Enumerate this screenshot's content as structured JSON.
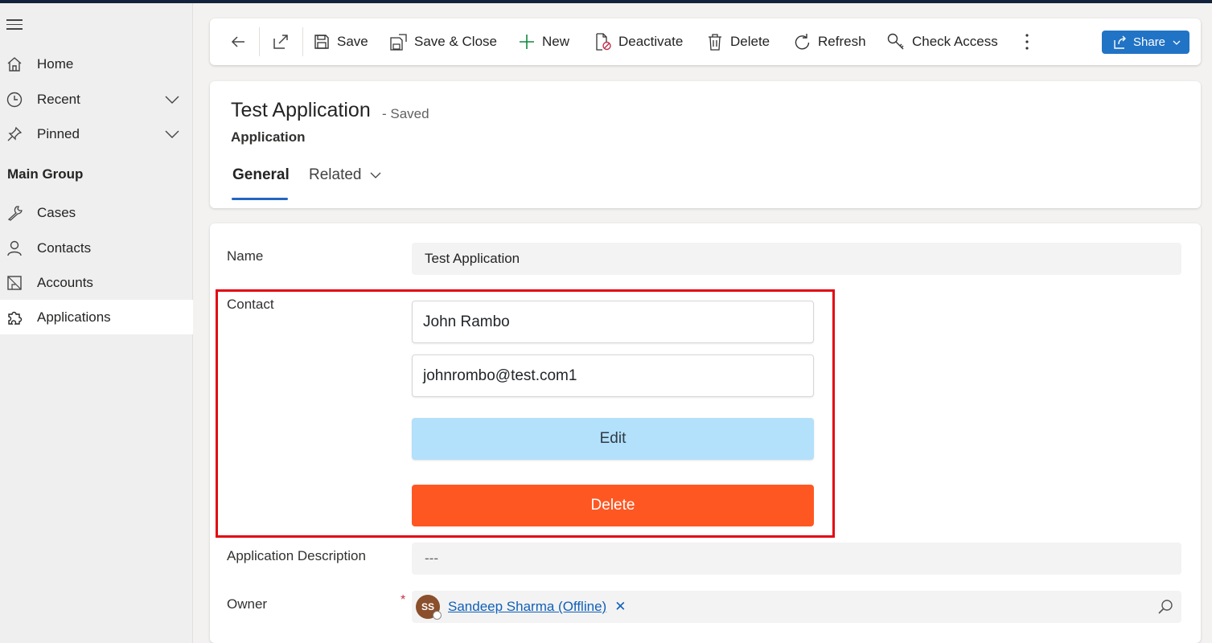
{
  "sidebar": {
    "items": [
      {
        "label": "Home"
      },
      {
        "label": "Recent"
      },
      {
        "label": "Pinned"
      },
      {
        "label": "Cases"
      },
      {
        "label": "Contacts"
      },
      {
        "label": "Accounts"
      },
      {
        "label": "Applications"
      }
    ],
    "group_label": "Main Group"
  },
  "toolbar": {
    "save": "Save",
    "save_close": "Save & Close",
    "new": "New",
    "deactivate": "Deactivate",
    "delete": "Delete",
    "refresh": "Refresh",
    "check_access": "Check Access",
    "share": "Share"
  },
  "record": {
    "title": "Test Application",
    "status": "- Saved",
    "entity": "Application"
  },
  "tabs": {
    "general": "General",
    "related": "Related"
  },
  "form": {
    "name_label": "Name",
    "name_value": "Test Application",
    "contact_label": "Contact",
    "contact_name": "John Rambo",
    "contact_email": "johnrombo@test.com1",
    "edit_button": "Edit",
    "delete_button": "Delete",
    "description_label": "Application Description",
    "description_value": "---",
    "owner_label": "Owner",
    "owner_required": "*",
    "owner_initials": "SS",
    "owner_name": "Sandeep Sharma (Offline)",
    "owner_remove": "✕"
  },
  "colors": {
    "accent": "#2173c5",
    "edit_button_bg": "#b3e0fb",
    "delete_button_bg": "#ff5722",
    "highlight_border": "#e30613"
  }
}
